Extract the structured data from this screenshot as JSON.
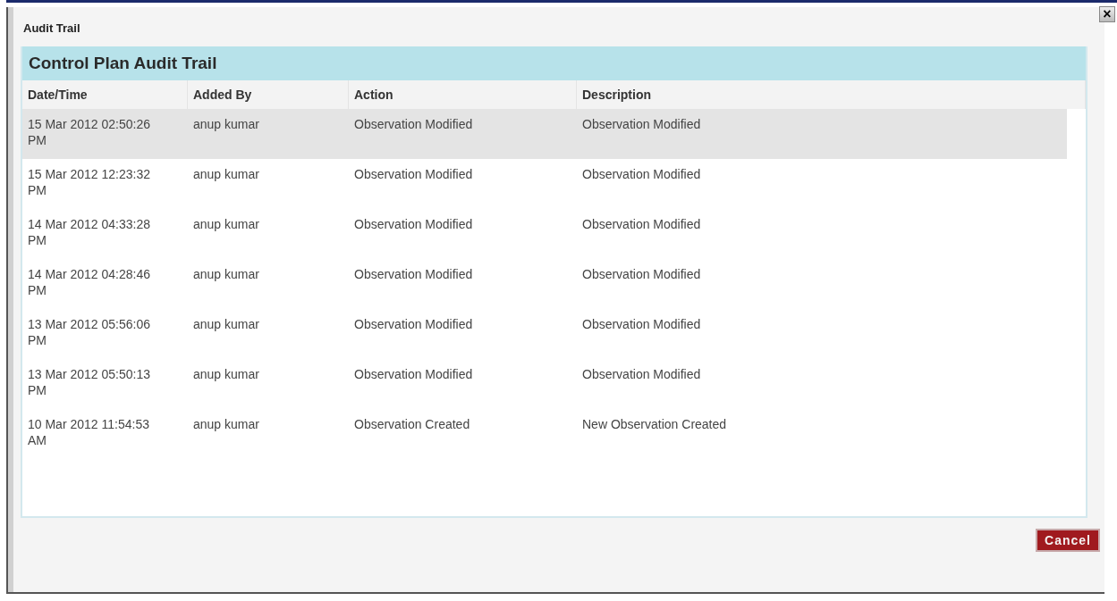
{
  "window": {
    "title": "Audit Trail",
    "close": "×"
  },
  "panel": {
    "title": "Control Plan Audit Trail"
  },
  "table": {
    "columns": [
      "Date/Time",
      "Added By",
      "Action",
      "Description"
    ],
    "rows": [
      {
        "cells": [
          "15 Mar 2012 02:50:26 PM",
          "anup kumar",
          "Observation Modified",
          "Observation Modified"
        ],
        "selected": true
      },
      {
        "cells": [
          "15 Mar 2012 12:23:32 PM",
          "anup kumar",
          "Observation Modified",
          "Observation Modified"
        ],
        "selected": false
      },
      {
        "cells": [
          "14 Mar 2012 04:33:28 PM",
          "anup kumar",
          "Observation Modified",
          "Observation Modified"
        ],
        "selected": false
      },
      {
        "cells": [
          "14 Mar 2012 04:28:46 PM",
          "anup kumar",
          "Observation Modified",
          "Observation Modified"
        ],
        "selected": false
      },
      {
        "cells": [
          "13 Mar 2012 05:56:06 PM",
          "anup kumar",
          "Observation Modified",
          "Observation Modified"
        ],
        "selected": false
      },
      {
        "cells": [
          "13 Mar 2012 05:50:13 PM",
          "anup kumar",
          "Observation Modified",
          "Observation Modified"
        ],
        "selected": false
      },
      {
        "cells": [
          "10 Mar 2012 11:54:53 AM",
          "anup kumar",
          "Observation Created",
          "New Observation Created"
        ],
        "selected": false
      }
    ]
  },
  "buttons": [
    "Cancel"
  ]
}
